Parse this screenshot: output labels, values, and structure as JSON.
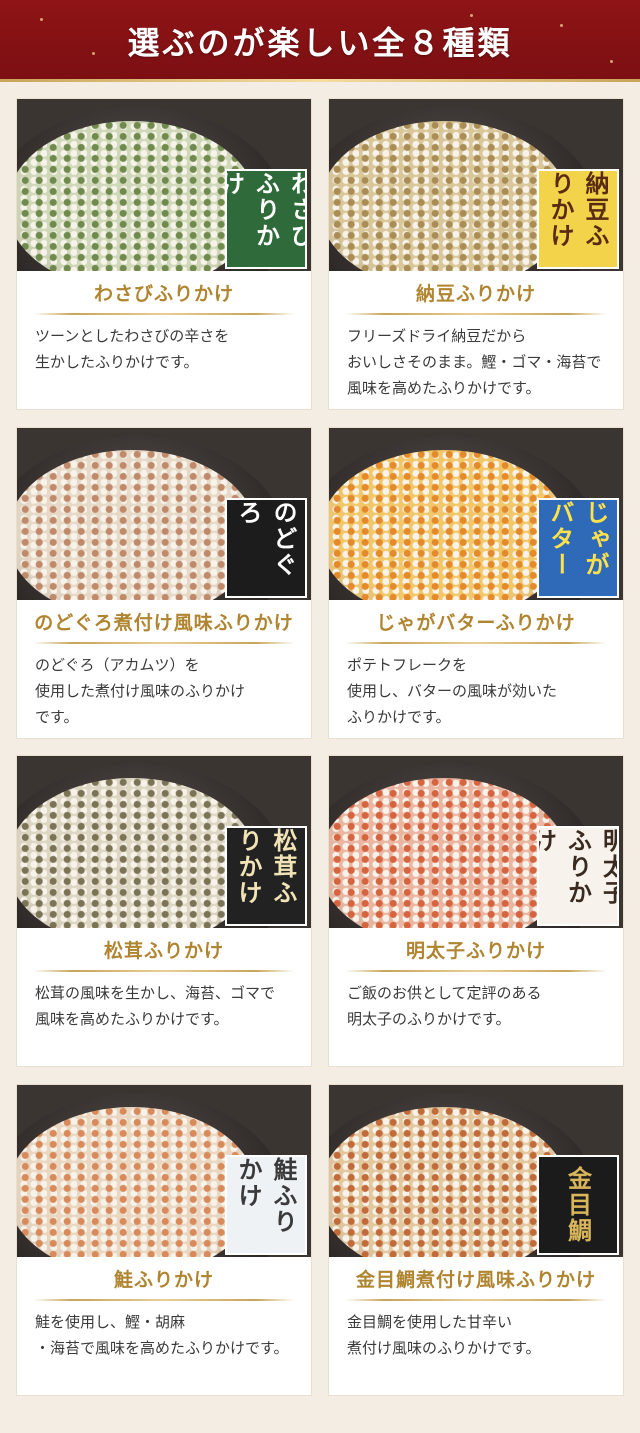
{
  "header": {
    "title": "選ぶのが楽しい全８種類"
  },
  "products": [
    {
      "name": "わさびふりかけ",
      "description": "ツーンとしたわさびの辛さを\n生かしたふりかけです。",
      "package_text": "わさびふりかけ",
      "colors": {
        "rice": "#cfd8b8",
        "topping": "#6f8a4c",
        "pkg_bg": "#2f6a3a",
        "pkg_fg": "#ffffff"
      }
    },
    {
      "name": "納豆ふりかけ",
      "description": "フリーズドライ納豆だから\nおいしさそのまま。鰹・ゴマ・海苔で\n風味を高めたふりかけです。",
      "package_text": "納豆ふりかけ",
      "colors": {
        "rice": "#d9c79a",
        "topping": "#a98d54",
        "pkg_bg": "#f3d34a",
        "pkg_fg": "#5a2b12"
      }
    },
    {
      "name": "のどぐろ煮付け風味ふりかけ",
      "description": "のどぐろ（アカムツ）を\n使用した煮付け風味のふりかけ\nです。",
      "package_text": "のどぐろ",
      "colors": {
        "rice": "#e6d9c8",
        "topping": "#c08a6a",
        "pkg_bg": "#1c1c1c",
        "pkg_fg": "#ffffff"
      }
    },
    {
      "name": "じゃがバターふりかけ",
      "description": "ポテトフレークを\n使用し、バターの風味が効いた\nふりかけです。",
      "package_text": "じゃがバター",
      "colors": {
        "rice": "#f1c76a",
        "topping": "#e58a2a",
        "pkg_bg": "#2f6ab8",
        "pkg_fg": "#ffe14a"
      }
    },
    {
      "name": "松茸ふりかけ",
      "description": "松茸の風味を生かし、海苔、ゴマで\n風味を高めたふりかけです。",
      "package_text": "松茸ふりかけ",
      "colors": {
        "rice": "#dcd6c2",
        "topping": "#7a7356",
        "pkg_bg": "#222222",
        "pkg_fg": "#f1e3b5"
      }
    },
    {
      "name": "明太子ふりかけ",
      "description": "ご飯のお供として定評のある\n明太子のふりかけです。",
      "package_text": "明太子ふりかけ",
      "colors": {
        "rice": "#eab6a2",
        "topping": "#d5643f",
        "pkg_bg": "#f7f3ec",
        "pkg_fg": "#3a2a20"
      }
    },
    {
      "name": "鮭ふりかけ",
      "description": "鮭を使用し、鰹・胡麻\n・海苔で風味を高めたふりかけです。",
      "package_text": "鮭ふりかけ",
      "colors": {
        "rice": "#e9d7c2",
        "topping": "#d88a5a",
        "pkg_bg": "#eef2f5",
        "pkg_fg": "#3a3a3a"
      }
    },
    {
      "name": "金目鯛煮付け風味ふりかけ",
      "description": "金目鯛を使用した甘辛い\n煮付け風味のふりかけです。",
      "package_text": "金目鯛",
      "colors": {
        "rice": "#e3c79e",
        "topping": "#c26b3a",
        "pkg_bg": "#1b1b1b",
        "pkg_fg": "#d8b45a"
      }
    }
  ]
}
